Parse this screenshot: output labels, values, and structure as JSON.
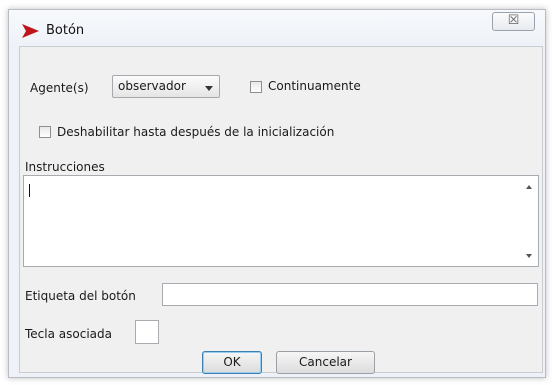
{
  "window": {
    "title": "Botón",
    "close_symbol": "☒",
    "icon": "red-arrow-icon",
    "accent_color": "#c0141b"
  },
  "form": {
    "agents_label": "Agente(s)",
    "agents_selected": "observador",
    "continuous_label": "Continuamente",
    "disable_until_init_label": "Deshabilitar hasta después de la inicialización",
    "instructions_label": "Instrucciones",
    "instructions_value": "",
    "button_label_label": "Etiqueta del botón",
    "button_label_value": "",
    "hotkey_label": "Tecla asociada",
    "hotkey_value": ""
  },
  "buttons": {
    "ok": "OK",
    "cancel": "Cancelar"
  }
}
